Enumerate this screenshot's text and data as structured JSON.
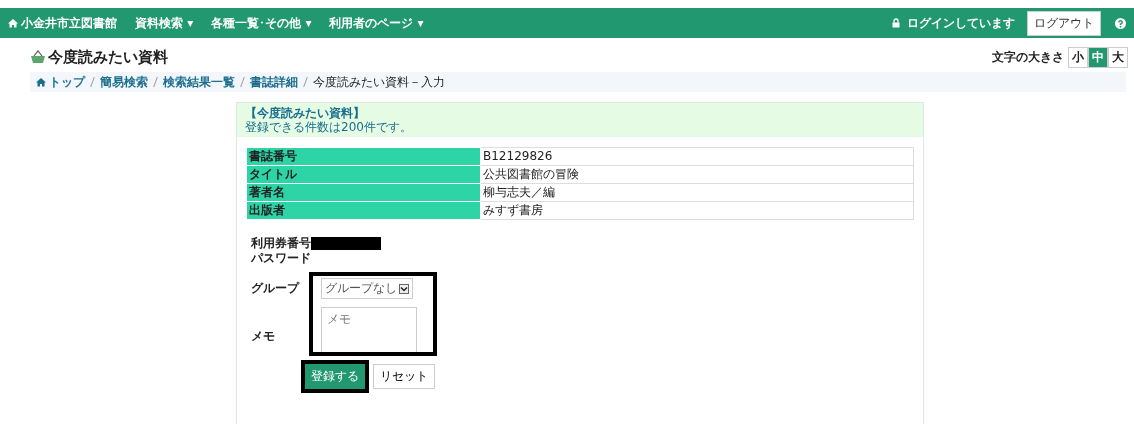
{
  "navbar": {
    "brand": "小金井市立図書館",
    "menus": [
      {
        "label": "資料検索 ▾"
      },
      {
        "label": "各種一覧･その他 ▾"
      },
      {
        "label": "利用者のページ ▾"
      }
    ],
    "login_status": "ログインしています",
    "logout": "ログアウト"
  },
  "page_title": "今度読みたい資料",
  "font_size": {
    "label": "文字の大きさ",
    "options": [
      {
        "label": "小",
        "selected": false
      },
      {
        "label": "中",
        "selected": true
      },
      {
        "label": "大",
        "selected": false
      }
    ]
  },
  "breadcrumb": {
    "links": [
      "トップ",
      "簡易検索",
      "検索結果一覧",
      "書誌詳細"
    ],
    "current": "今度読みたい資料－入力"
  },
  "notice": {
    "title": "【今度読みたい資料】",
    "text": "登録できる件数は200件です。"
  },
  "details": [
    {
      "label": "書誌番号",
      "value": "B12129826"
    },
    {
      "label": "タイトル",
      "value": "公共図書館の冒険"
    },
    {
      "label": "著者名",
      "value": "柳与志夫／編"
    },
    {
      "label": "出版者",
      "value": "みすず書房"
    }
  ],
  "form": {
    "card_number_label": "利用券番号",
    "password_label": "パスワード",
    "group_label": "グループ",
    "group_value": "グループなし",
    "memo_label": "メモ",
    "memo_placeholder": "メモ"
  },
  "buttons": {
    "submit": "登録する",
    "reset": "リセット"
  }
}
